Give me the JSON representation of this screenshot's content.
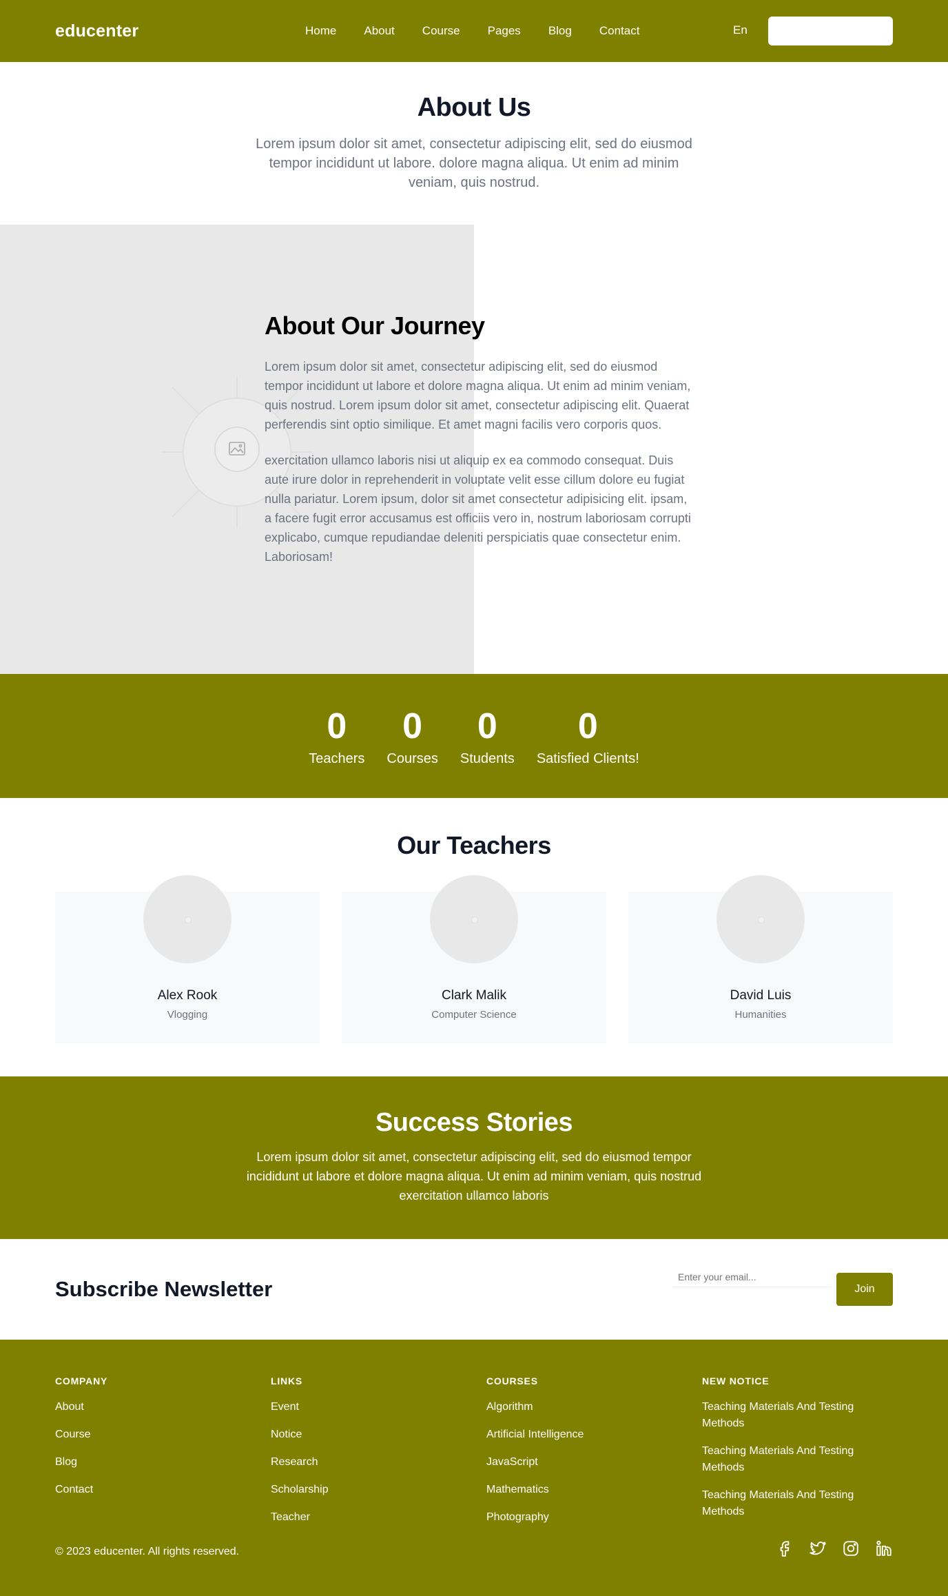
{
  "header": {
    "logo": "educenter",
    "nav": [
      "Home",
      "About",
      "Course",
      "Pages",
      "Blog",
      "Contact"
    ],
    "language": "En"
  },
  "about_us": {
    "title": "About Us",
    "text": "Lorem ipsum dolor sit amet, consectetur adipiscing elit, sed do eiusmod tempor incididunt ut labore. dolore magna aliqua. Ut enim ad minim veniam, quis nostrud."
  },
  "journey": {
    "title": "About Our Journey",
    "paragraph1": "Lorem ipsum dolor sit amet, consectetur adipiscing elit, sed do eiusmod tempor incididunt ut labore et dolore magna aliqua. Ut enim ad minim veniam, quis nostrud. Lorem ipsum dolor sit amet, consectetur adipiscing elit. Quaerat perferendis sint optio similique. Et amet magni facilis vero corporis quos.",
    "paragraph2": "exercitation ullamco laboris nisi ut aliquip ex ea commodo consequat. Duis aute irure dolor in reprehenderit in voluptate velit esse cillum dolore eu fugiat nulla pariatur. Lorem ipsum, dolor sit amet consectetur adipisicing elit. ipsam, a facere fugit error accusamus est officiis vero in, nostrum laboriosam corrupti explicabo, cumque repudiandae deleniti perspiciatis quae consectetur enim. Laboriosam!"
  },
  "stats": [
    {
      "value": "0",
      "label": "Teachers"
    },
    {
      "value": "0",
      "label": "Courses"
    },
    {
      "value": "0",
      "label": "Students"
    },
    {
      "value": "0",
      "label": "Satisfied Clients!"
    }
  ],
  "teachers": {
    "title": "Our Teachers",
    "items": [
      {
        "name": "Alex Rook",
        "role": "Vlogging"
      },
      {
        "name": "Clark Malik",
        "role": "Computer Science"
      },
      {
        "name": "David Luis",
        "role": "Humanities"
      }
    ]
  },
  "success": {
    "title": "Success Stories",
    "text": "Lorem ipsum dolor sit amet, consectetur adipiscing elit, sed do eiusmod tempor incididunt ut labore et dolore magna aliqua. Ut enim ad minim veniam, quis nostrud exercitation ullamco laboris"
  },
  "newsletter": {
    "title": "Subscribe Newsletter",
    "placeholder": "Enter your email...",
    "button": "Join"
  },
  "footer": {
    "company": {
      "heading": "COMPANY",
      "links": [
        "About",
        "Course",
        "Blog",
        "Contact"
      ]
    },
    "links": {
      "heading": "LINKS",
      "links": [
        "Event",
        "Notice",
        "Research",
        "Scholarship",
        "Teacher"
      ]
    },
    "courses": {
      "heading": "COURSES",
      "links": [
        "Algorithm",
        "Artificial Intelligence",
        "JavaScript",
        "Mathematics",
        "Photography"
      ]
    },
    "notice": {
      "heading": "NEW NOTICE",
      "items": [
        "Teaching Materials And Testing Methods",
        "Teaching Materials And Testing Methods",
        "Teaching Materials And Testing Methods"
      ]
    },
    "copyright": "© 2023 educenter. All rights reserved.",
    "socials": [
      "facebook-icon",
      "twitter-icon",
      "instagram-icon",
      "linkedin-icon"
    ]
  },
  "colors": {
    "brand": "#808000",
    "text_dark": "#111827",
    "text_muted": "#6b7280",
    "placeholder_bg": "#e8e8e8"
  }
}
